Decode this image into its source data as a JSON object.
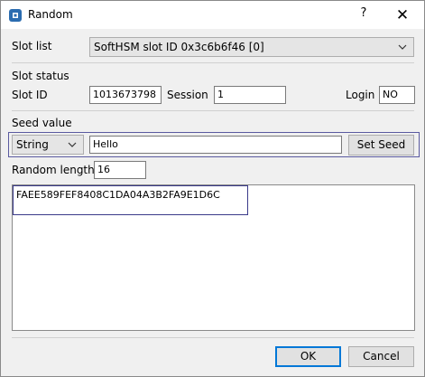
{
  "window": {
    "title": "Random",
    "help_label": "?",
    "close_label": "✕"
  },
  "slot_list": {
    "label": "Slot list",
    "value": "SoftHSM slot ID 0x3c6b6f46 [0]"
  },
  "slot_status": {
    "heading": "Slot status",
    "slot_id_label": "Slot ID",
    "slot_id_value": "1013673798",
    "session_label": "Session",
    "session_value": "1",
    "login_label": "Login",
    "login_value": "NO"
  },
  "seed": {
    "heading": "Seed value",
    "type_value": "String",
    "seed_value": "Hello",
    "set_seed_label": "Set Seed"
  },
  "random": {
    "length_label": "Random length",
    "length_value": "16",
    "result": "FAEE589FEF8408C1DA04A3B2FA9E1D6C"
  },
  "buttons": {
    "ok_label": "OK",
    "cancel_label": "Cancel"
  },
  "colors": {
    "accent": "#0078d7",
    "focus_frame": "#5a5aa0"
  },
  "icons": {
    "app": "chip-icon",
    "dropdown": "chevron-down-icon"
  }
}
